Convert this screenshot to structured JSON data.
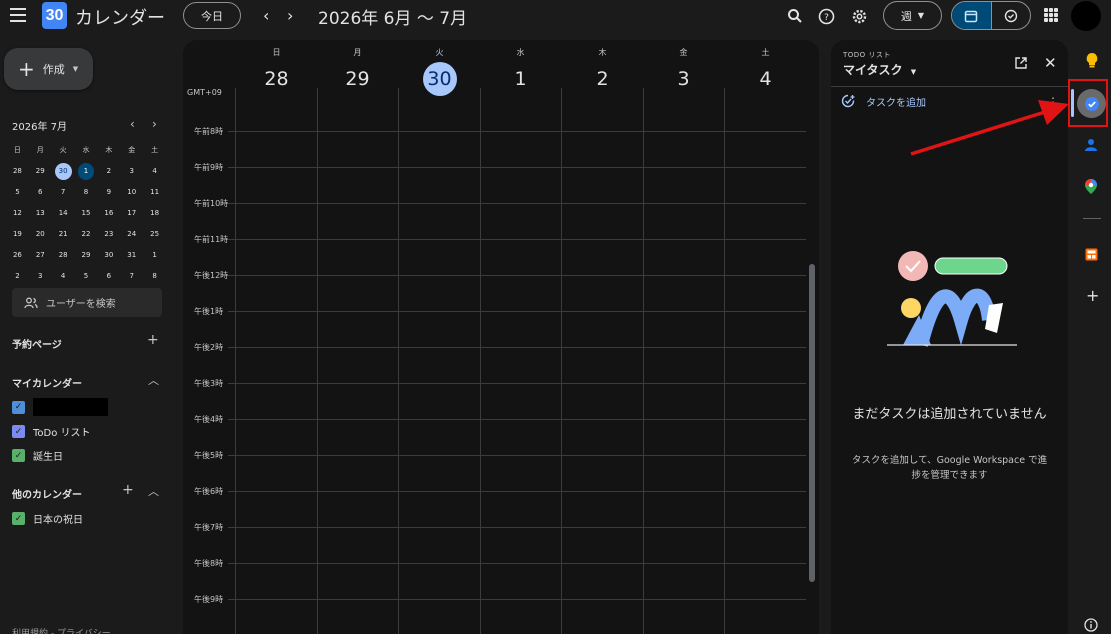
{
  "header": {
    "app_title": "カレンダー",
    "logo_number": "30",
    "today_button": "今日",
    "date_range": "2026年 6月 ～ 7月",
    "view_button": "週"
  },
  "sidebar": {
    "create_label": "作成",
    "mini_month": "2026年 7月",
    "mini_weekdays": [
      "日",
      "月",
      "火",
      "水",
      "木",
      "金",
      "土"
    ],
    "mini_rows": [
      [
        "28",
        "29",
        "30",
        "1",
        "2",
        "3",
        "4"
      ],
      [
        "5",
        "6",
        "7",
        "8",
        "9",
        "10",
        "11"
      ],
      [
        "12",
        "13",
        "14",
        "15",
        "16",
        "17",
        "18"
      ],
      [
        "19",
        "20",
        "21",
        "22",
        "23",
        "24",
        "25"
      ],
      [
        "26",
        "27",
        "28",
        "29",
        "30",
        "31",
        "1"
      ],
      [
        "2",
        "3",
        "4",
        "5",
        "6",
        "7",
        "8"
      ]
    ],
    "search_users": "ユーザーを検索",
    "booking_pages": "予約ページ",
    "my_calendars": "マイカレンダー",
    "my_calendar_items": [
      "",
      "ToDo リスト",
      "誕生日"
    ],
    "other_calendars": "他のカレンダー",
    "other_calendar_items": [
      "日本の祝日"
    ],
    "footer": "利用規約 - プライバシー"
  },
  "calendar": {
    "timezone": "GMT+09",
    "days": [
      {
        "name": "日",
        "date": "28"
      },
      {
        "name": "月",
        "date": "29"
      },
      {
        "name": "火",
        "date": "30"
      },
      {
        "name": "水",
        "date": "1"
      },
      {
        "name": "木",
        "date": "2"
      },
      {
        "name": "金",
        "date": "3"
      },
      {
        "name": "土",
        "date": "4"
      }
    ],
    "hours": [
      "午前8時",
      "午前9時",
      "午前10時",
      "午前11時",
      "午後12時",
      "午後1時",
      "午後2時",
      "午後3時",
      "午後4時",
      "午後5時",
      "午後6時",
      "午後7時",
      "午後8時",
      "午後9時"
    ]
  },
  "tasks": {
    "label": "TODO リスト",
    "list_name": "マイタスク",
    "add_task": "タスクを追加",
    "empty_title": "まだタスクは追加されていません",
    "empty_subtitle": "タスクを追加して、Google Workspace で進捗を管理できます"
  },
  "colors": {
    "accent": "#a8c7fa",
    "check_blue": "#4f8fd9",
    "check_purple": "#7b8cf0",
    "check_green": "#58b06a",
    "annotation_red": "#e01414"
  }
}
